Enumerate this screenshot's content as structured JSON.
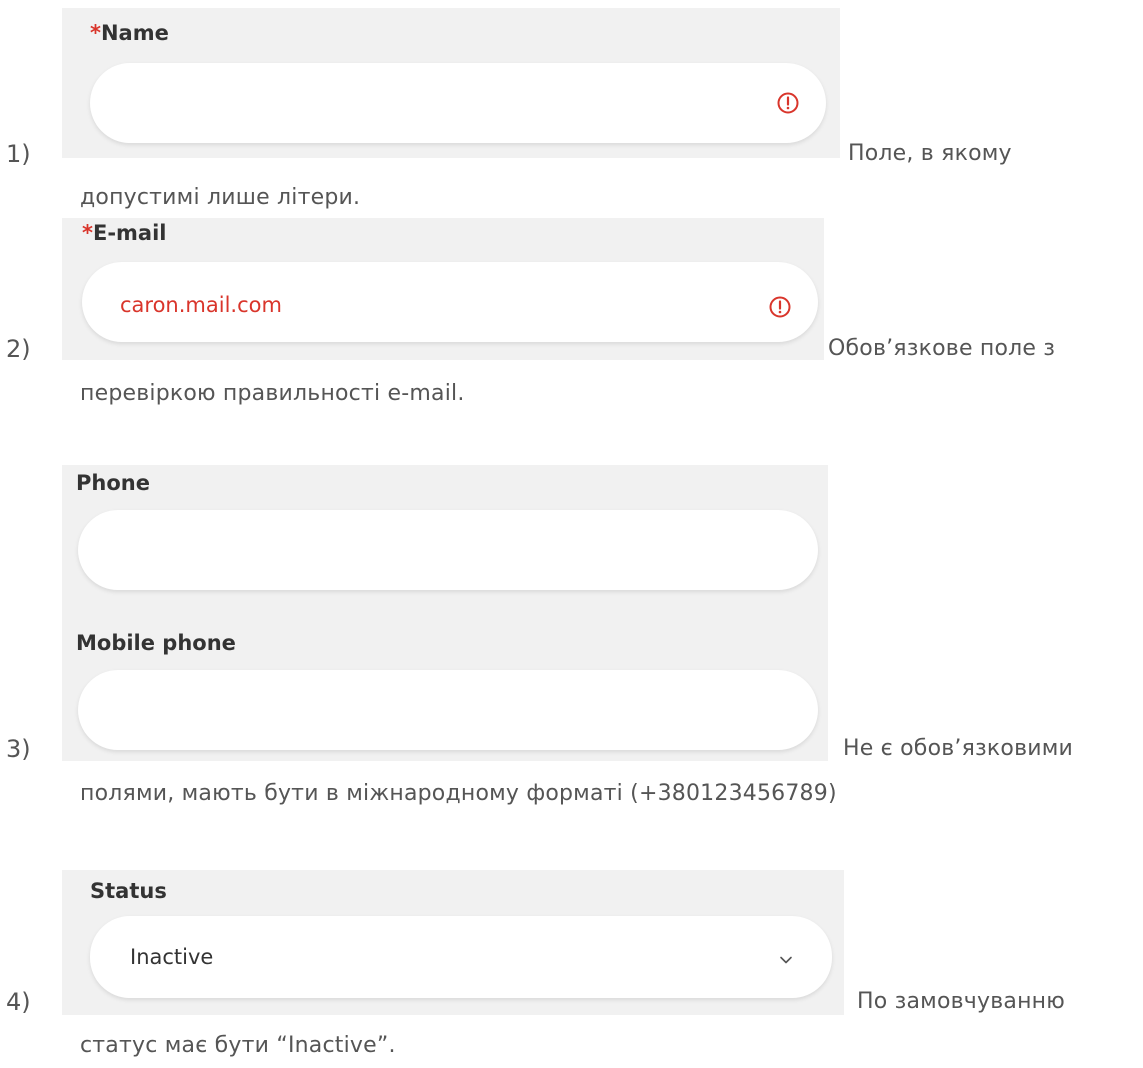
{
  "items": [
    {
      "number": "1)",
      "field": {
        "required_mark": "*",
        "label": "Name",
        "value": ""
      },
      "caption_line1": "Поле, в якому",
      "caption_line2": "допустимі лише літери."
    },
    {
      "number": "2)",
      "field": {
        "required_mark": "*",
        "label": "E-mail",
        "value": "caron.mail.com"
      },
      "caption_line1": "Обов’язкове поле з",
      "caption_line2": "перевіркою правильності e-mail."
    },
    {
      "number": "3)",
      "fields": [
        {
          "label": "Phone",
          "value": ""
        },
        {
          "label": "Mobile phone",
          "value": ""
        }
      ],
      "caption_line1": "Не є обов’язковими",
      "caption_line2": "полями, мають бути в міжнародному форматі (+380123456789)"
    },
    {
      "number": "4)",
      "field": {
        "label": "Status",
        "value": "Inactive"
      },
      "caption_line1": "По замовчуванню",
      "caption_line2": "статус має бути “Inactive”."
    }
  ],
  "icons": {
    "error": "exclamation-circle-icon",
    "dropdown": "chevron-down-icon"
  },
  "colors": {
    "error_red": "#d9352b",
    "panel_bg": "#f1f1f1",
    "text_gray": "#555555"
  }
}
